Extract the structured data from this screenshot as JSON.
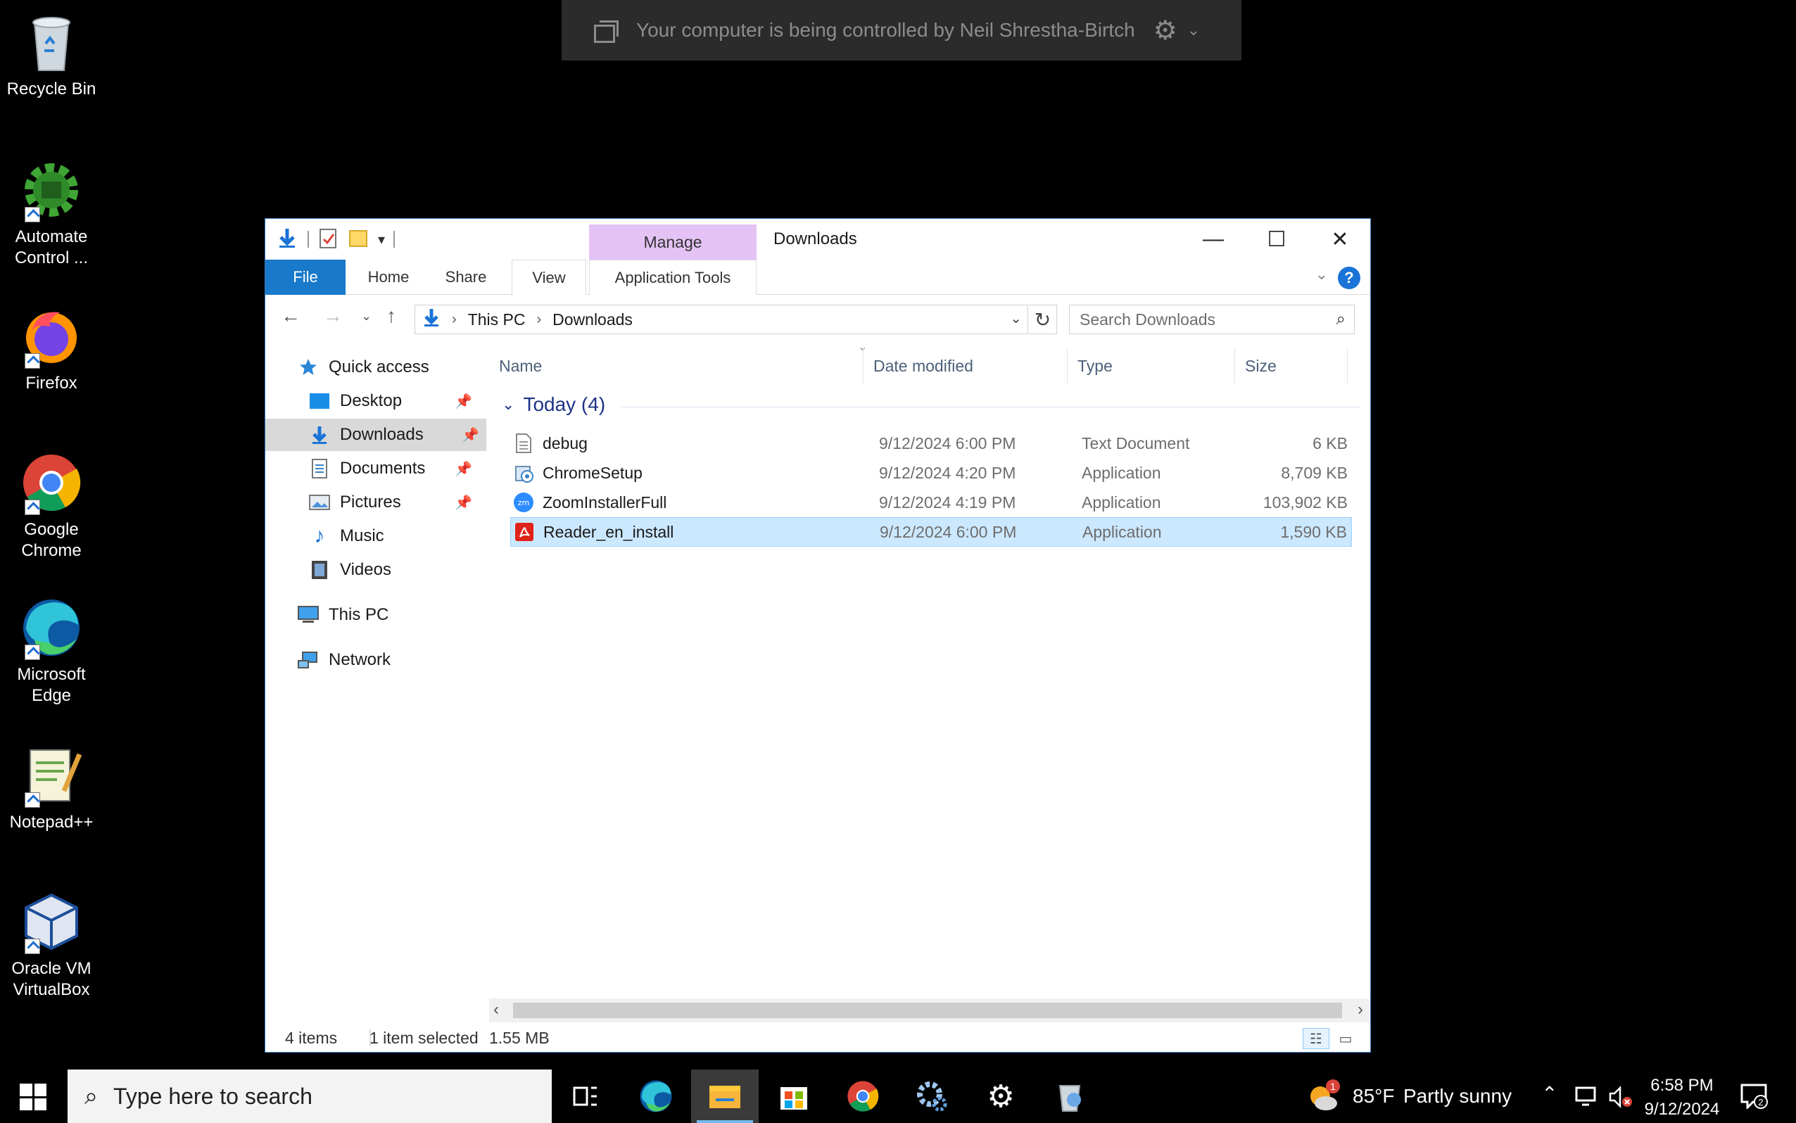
{
  "banner": {
    "text": "Your computer is being controlled by Neil Shrestha-Birtch"
  },
  "desktop": {
    "icons": [
      {
        "label": "Recycle Bin"
      },
      {
        "label": "Automate Control ..."
      },
      {
        "label": "Firefox"
      },
      {
        "label": "Google Chrome"
      },
      {
        "label": "Microsoft Edge"
      },
      {
        "label": "Notepad++"
      },
      {
        "label": "Oracle VM VirtualBox"
      }
    ]
  },
  "window": {
    "title": "Downloads",
    "manage_tab": "Manage",
    "ribbon": {
      "tabs": [
        "File",
        "Home",
        "Share",
        "View",
        "Application Tools"
      ],
      "help": "?"
    },
    "address": {
      "crumbs": [
        "This PC",
        "Downloads"
      ],
      "search_placeholder": "Search Downloads"
    },
    "nav": {
      "quick_access": "Quick access",
      "items": [
        "Desktop",
        "Downloads",
        "Documents",
        "Pictures",
        "Music",
        "Videos"
      ],
      "this_pc": "This PC",
      "network": "Network"
    },
    "columns": [
      "Name",
      "Date modified",
      "Type",
      "Size"
    ],
    "group": {
      "label": "Today (4)"
    },
    "files": [
      {
        "name": "debug",
        "date": "9/12/2024 6:00 PM",
        "type": "Text Document",
        "size": "6 KB",
        "icon": "text-file-icon"
      },
      {
        "name": "ChromeSetup",
        "date": "9/12/2024 4:20 PM",
        "type": "Application",
        "size": "8,709 KB",
        "icon": "installer-icon"
      },
      {
        "name": "ZoomInstallerFull",
        "date": "9/12/2024 4:19 PM",
        "type": "Application",
        "size": "103,902 KB",
        "icon": "zoom-icon"
      },
      {
        "name": "Reader_en_install",
        "date": "9/12/2024 6:00 PM",
        "type": "Application",
        "size": "1,590 KB",
        "icon": "acrobat-icon"
      }
    ],
    "status": {
      "items": "4 items",
      "selected": "1 item selected",
      "size": "1.55 MB"
    }
  },
  "taskbar": {
    "search_placeholder": "Type here to search",
    "weather": {
      "temp": "85°F",
      "condition": "Partly sunny",
      "badge": "1"
    },
    "clock": {
      "time": "6:58 PM",
      "date": "9/12/2024"
    },
    "notifications": "2"
  },
  "colors": {
    "accent": "#1979ca",
    "selection": "#cce8ff",
    "manage": "#e4c3f4",
    "group_text": "#1e3287"
  }
}
